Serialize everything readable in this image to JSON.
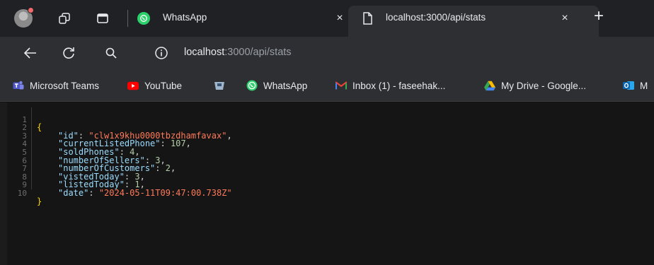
{
  "browser": {
    "tabs": [
      {
        "title": "WhatsApp",
        "close": "×"
      },
      {
        "title": "localhost:3000/api/stats",
        "close": "×"
      }
    ],
    "new_tab": "+",
    "address": {
      "host": "localhost",
      "rest": ":3000/api/stats"
    },
    "bookmarks": [
      {
        "label": "Microsoft Teams",
        "icon": "teams-icon"
      },
      {
        "label": "YouTube",
        "icon": "youtube-icon"
      },
      {
        "label": "",
        "icon": "bookmark-app-icon"
      },
      {
        "label": "WhatsApp",
        "icon": "whatsapp-icon"
      },
      {
        "label": "Inbox (1) - faseehak...",
        "icon": "gmail-icon"
      },
      {
        "label": "My Drive - Google...",
        "icon": "google-drive-icon"
      },
      {
        "label": "M",
        "icon": "outlook-icon"
      }
    ]
  },
  "json_view": {
    "line_numbers": [
      "1",
      "2",
      "3",
      "4",
      "5",
      "6",
      "7",
      "8",
      "9",
      "10"
    ],
    "open": "{",
    "close": "}",
    "entries": [
      {
        "key": "\"id\"",
        "value": "\"clw1x9khu0000tbzdhamfavax\"",
        "sep": ","
      },
      {
        "key": "\"currentListedPhone\"",
        "value": "107",
        "sep": ","
      },
      {
        "key": "\"soldPhones\"",
        "value": "4",
        "sep": ","
      },
      {
        "key": "\"numberOfSellers\"",
        "value": "3",
        "sep": ","
      },
      {
        "key": "\"numberOfCustomers\"",
        "value": "2",
        "sep": ","
      },
      {
        "key": "\"vistedToday\"",
        "value": "3",
        "sep": ","
      },
      {
        "key": "\"listedToday\"",
        "value": "1",
        "sep": ","
      },
      {
        "key": "\"date\"",
        "value": "\"2024-05-11T09:47:00.738Z\"",
        "sep": ""
      }
    ]
  }
}
